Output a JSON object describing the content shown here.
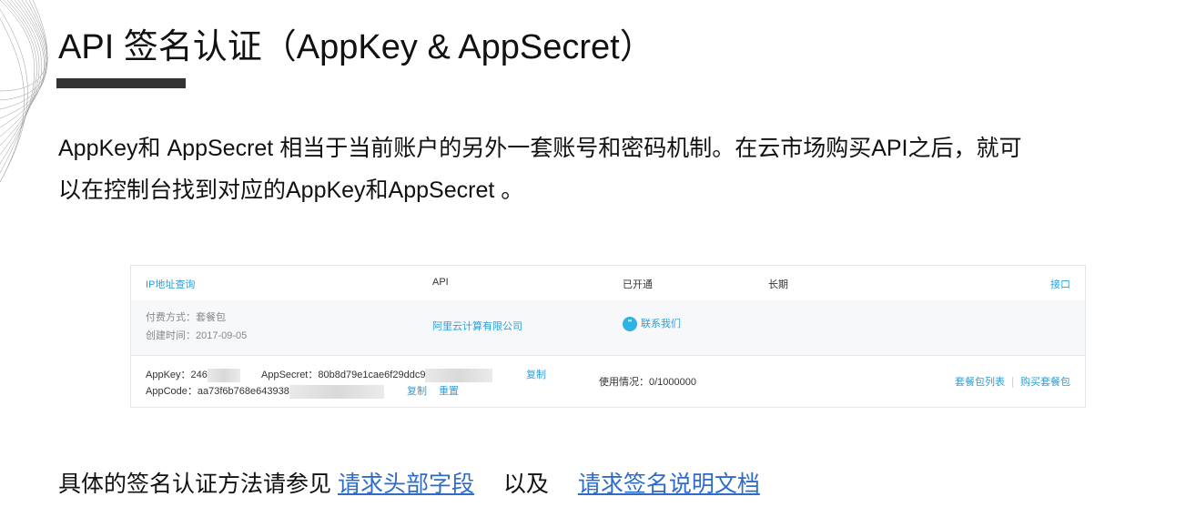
{
  "slide": {
    "title": "API 签名认证（AppKey & AppSecret）",
    "intro_line1": "AppKey和 AppSecret 相当于当前账户的另外一套账号和密码机制。在云市场购买API之后，就可",
    "intro_line2": "以在控制台找到对应的AppKey和AppSecret 。"
  },
  "panel": {
    "header": {
      "name": "IP地址查询",
      "type": "API",
      "status": "已开通",
      "term": "长期",
      "action": "接口"
    },
    "info": {
      "pay_method": "付费方式：套餐包",
      "created": "创建时间：2017-09-05",
      "provider": "阿里云计算有限公司",
      "contact": "联系我们"
    },
    "credentials": {
      "appkey_label": "AppKey：",
      "appkey_value": "246",
      "appsecret_label": "AppSecret：",
      "appsecret_value": "80b8d79e1cae6f29ddc9",
      "copy_label": "复制",
      "appcode_label": "AppCode：",
      "appcode_value": "aa73f6b768e643938",
      "copy2_label": "复制",
      "reset_label": "重置",
      "usage": "使用情况：0/1000000",
      "plan_list": "套餐包列表",
      "buy_plan": "购买套餐包"
    }
  },
  "footer": {
    "prefix": "具体的签名认证方法请参见",
    "link1": "请求头部字段",
    "middle": "以及",
    "link2": "请求签名说明文档"
  }
}
